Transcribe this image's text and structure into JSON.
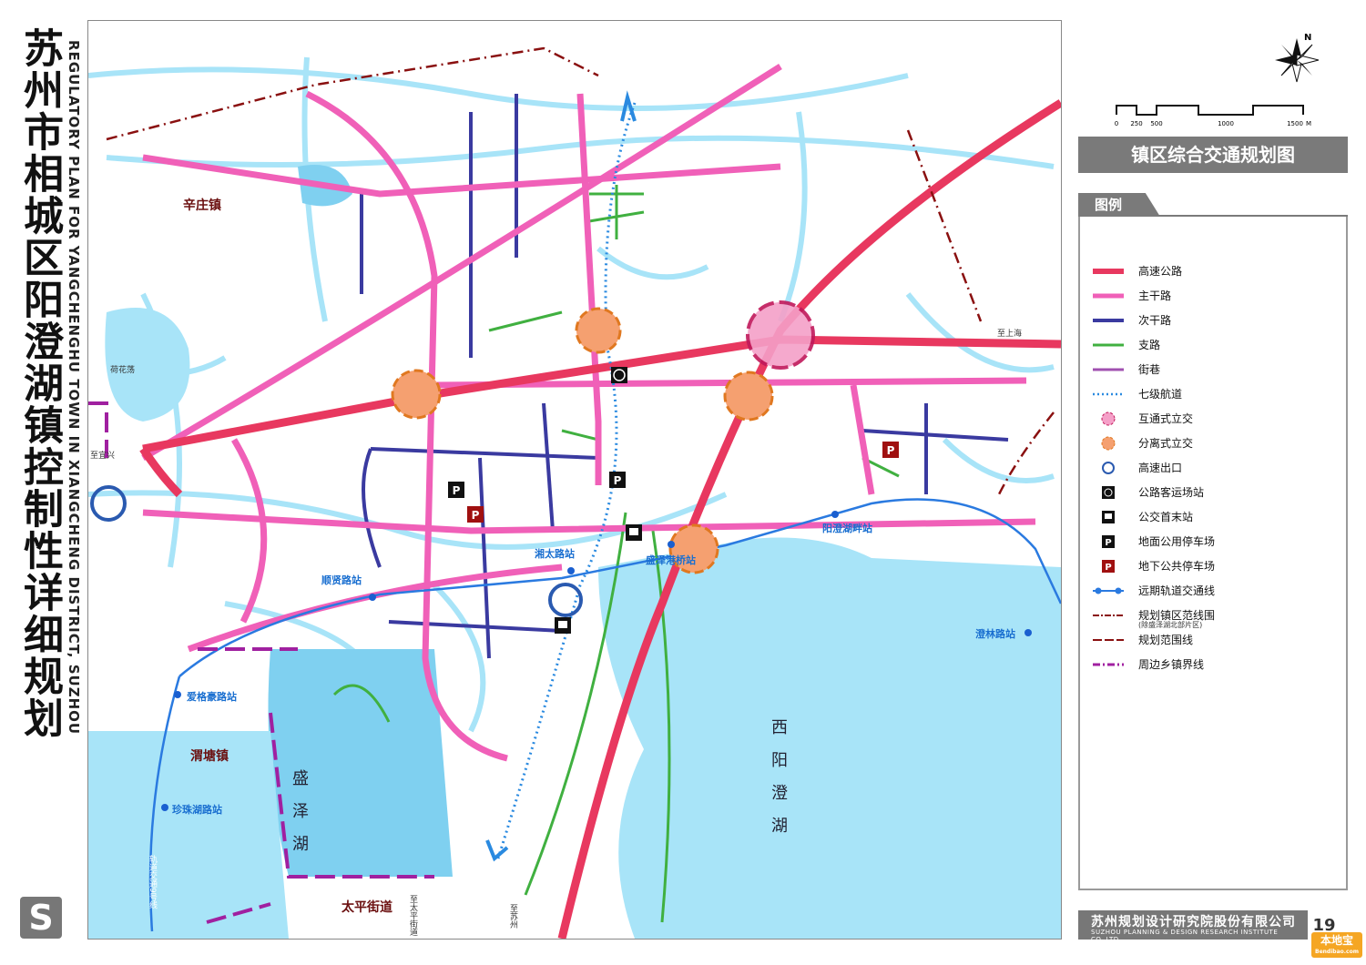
{
  "title": {
    "cn": "苏州市相城区阳澄湖镇控制性详细规划",
    "en": "REGULATORY PLAN FOR YANGCHENGHU TOWN IN XIANGCHENG DISTRICT, SUZHOU"
  },
  "plan_title": "镇区综合交通规划图",
  "legend": {
    "heading": "图例",
    "items": [
      {
        "label": "高速公路",
        "symbol": "expressway",
        "color": "#e8385f"
      },
      {
        "label": "主干路",
        "symbol": "arterial",
        "color": "#f060b8"
      },
      {
        "label": "次干路",
        "symbol": "secondary",
        "color": "#3a3aa0"
      },
      {
        "label": "支路",
        "symbol": "branch",
        "color": "#40b040"
      },
      {
        "label": "街巷",
        "symbol": "lane",
        "color": "#a050b0"
      },
      {
        "label": "七级航道",
        "symbol": "waterway",
        "color": "#2a8ae0"
      },
      {
        "label": "互通式立交",
        "symbol": "interchange",
        "color": "#f5a0c8"
      },
      {
        "label": "分离式立交",
        "symbol": "separated-interchange",
        "color": "#f5a070"
      },
      {
        "label": "高速出口",
        "symbol": "exit",
        "color": "#2a5ab0"
      },
      {
        "label": "公路客运场站",
        "symbol": "coach-station-icon",
        "color": "#111111"
      },
      {
        "label": "公交首末站",
        "symbol": "bus-terminal-icon",
        "color": "#111111"
      },
      {
        "label": "地面公用停车场",
        "symbol": "surface-parking-icon",
        "color": "#111111"
      },
      {
        "label": "地下公共停车场",
        "symbol": "underground-parking-icon",
        "color": "#a01010"
      },
      {
        "label": "远期轨道交通线",
        "symbol": "rail",
        "color": "#2a7ae0"
      },
      {
        "label": "规划镇区范线围",
        "sublabel": "(除盛泽湖北部片区)",
        "symbol": "town-boundary",
        "color": "#8a1010"
      },
      {
        "label": "规划范围线",
        "symbol": "plan-boundary",
        "color": "#8a1010"
      },
      {
        "label": "周边乡镇界线",
        "symbol": "township-boundary",
        "color": "#a020a0"
      }
    ]
  },
  "scale": {
    "ticks": [
      "0",
      "250",
      "500",
      "1000",
      "1500"
    ],
    "unit": "M"
  },
  "north_label": "N",
  "map": {
    "places": [
      "辛庄镇",
      "渭塘镇",
      "太平街道"
    ],
    "lakes": [
      "盛泽湖",
      "西阳澄湖"
    ],
    "stations": [
      "湘太路站",
      "盛泽港桥站",
      "阳澄湖畔站",
      "顺贤路站",
      "爱格豪路站",
      "珍珠湖路站",
      "澄林路站"
    ],
    "labels": {
      "to_shanghai": "至上海",
      "to_yixing": "至宜兴",
      "huakanang": "荷花荡",
      "rail9": "轨道交通9号线",
      "to_taiping": "至太平街道",
      "to_suzhou": "至苏州"
    }
  },
  "footer": {
    "company_cn": "苏州规划设计研究院股份有限公司",
    "company_en": "SUZHOU PLANNING & DESIGN RESEARCH INSTITUTE CO.,LTD",
    "page": "19"
  },
  "watermark": {
    "text": "本地宝",
    "sub": "Bendibao.com"
  },
  "colors": {
    "water": "#a8e4f8",
    "lake": "#7fd0f0",
    "gray_panel": "#7a7a7a"
  }
}
